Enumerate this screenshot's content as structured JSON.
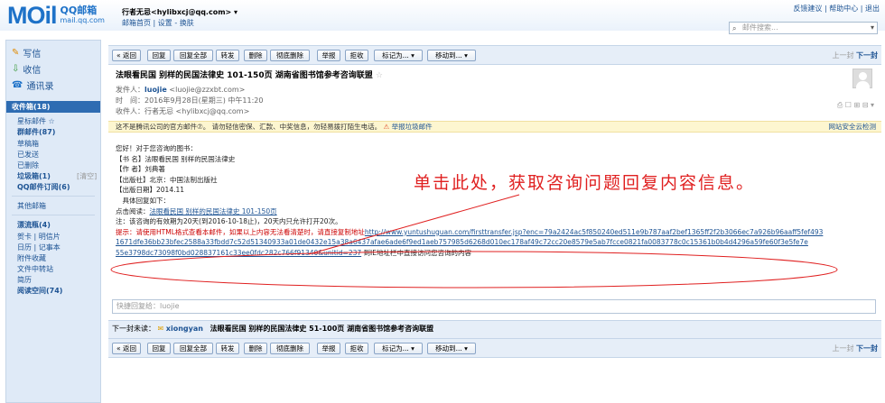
{
  "header": {
    "logo_text": "MOil",
    "logo_sub1": "QQ邮箱",
    "logo_sub2": "mail.qq.com",
    "user_line": "行者无忌<hylibxcj@qq.com> ▾",
    "user_links": "邮箱首页 | 设置 - 换肤",
    "top_links": "反馈建议 | 帮助中心 | 退出",
    "search_placeholder": "邮件搜索..."
  },
  "sidebar": {
    "compose": "写信",
    "receive": "收信",
    "contacts": "通讯录",
    "inbox": "收件箱(18)",
    "items": [
      "星标邮件 ☆",
      "群邮件(87)",
      "草稿箱",
      "已发送",
      "已删除",
      "垃圾箱(1)",
      "[清空]",
      "QQ邮件订阅(6)",
      "其他邮箱",
      "漂流瓶(4)",
      "贺卡 | 明信片",
      "日历 | 记事本",
      "附件收藏",
      "文件中转站",
      "简历",
      "阅读空间(74)"
    ]
  },
  "toolbar": {
    "buttons": [
      "« 返回",
      "回复",
      "回复全部",
      "转发",
      "删除",
      "彻底删除",
      "举报",
      "拒收",
      "标记为... ▾",
      "移动到... ▾"
    ],
    "nav": "上一封",
    "nav_next": "下一封"
  },
  "email": {
    "subject": "法眼看民国 别样的民国法律史 101-150页 湖南省图书馆参考咨询联盟",
    "star": "☆",
    "from_label": "发件人：",
    "from_name": "luojie",
    "from_addr": "<luojie@zzxbt.com>",
    "time": "时　间：2016年9月28日(星期三) 中午11:20",
    "to": "收件人：行者无忌 <hylibxcj@qq.com>",
    "meta_icons": "⎙ ☐ ⊞ ⊟ ▾",
    "warning": "这不是腾讯公司的官方邮件⑦。 请勿轻信密保、汇款、中奖信息，勿轻易拨打陌生电话。",
    "warning_link": "举报垃圾邮件",
    "warning_right": "网站安全云检测"
  },
  "body": {
    "l1": "您好！对于您咨询的图书：",
    "l2": "【书 名】法眼看民国 别样的民国法律史",
    "l3": "【作 者】刘典著",
    "l4": "【出版社】北京：中国法制出版社",
    "l5": "【出版日期】2014.11",
    "l6": "　具体回复如下：",
    "l7_prefix": "点击阅读：",
    "l7_link": "法眼看民国 别样的民国法律史 101-150页",
    "l8": "注：该咨询的有效期为20天(到2016-10-18止)，20天内只允许打开20次。",
    "l9_prefix": "提示：请使用HTML格式查看本邮件，如果以上内容无法看清楚时，请直接复制地址",
    "l9_link": "http://www.yuntushuguan.com/firsttransfer.jsp?enc=79a2424ac5f850240ed511e9b787aaf2bef1365ff2f2b3066ec7a926b96aaff5fef493",
    "l10_link": "1671dfe36bb23bfec2588a33fbdd7c52d51340933a01de0432e15a38a6437afae6ade6f9ed1aeb757985d6268d010ec178af49c72cc20e8579e5ab7fcce0821fa0083778c0c15361b0b4d4296a59fe60f3e5fe7e",
    "l11_link": "55e3798dc73098f0bd028837161c33ee0fdc282c766f91340&unitid=237",
    "l11_suffix": " 到IE地址栏中直接访问您咨询的内容"
  },
  "annotation": "单击此处，获取咨询问题回复内容信息。",
  "reply_placeholder": "快捷回复给：luojie",
  "next_mail": {
    "label": "下一封未读：",
    "from": "xiongyan",
    "subject": "法眼看民国 别样的民国法律史 51-100页 湖南省图书馆参考咨询联盟"
  }
}
